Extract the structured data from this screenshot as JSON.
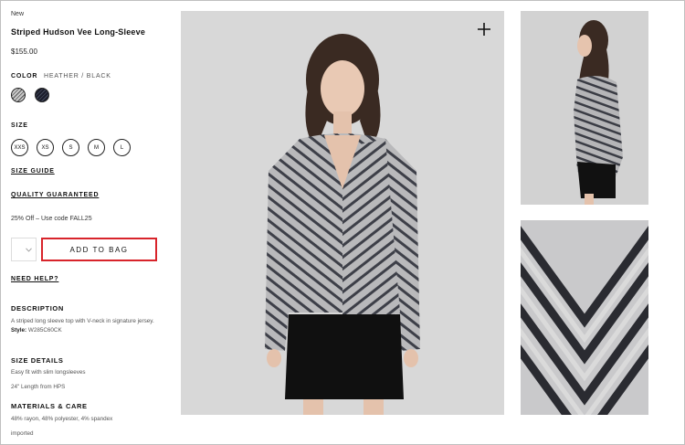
{
  "product": {
    "tag": "New",
    "title": "Striped Hudson Vee Long-Sleeve",
    "price": "$155.00"
  },
  "color": {
    "label": "COLOR",
    "value": "HEATHER / BLACK",
    "swatches": [
      "heather-grey",
      "black"
    ]
  },
  "size": {
    "label": "SIZE",
    "options": [
      "XXS",
      "XS",
      "S",
      "M",
      "L"
    ]
  },
  "links": {
    "size_guide": "SIZE GUIDE",
    "quality": "QUALITY GUARANTEED",
    "need_help": "NEED HELP?"
  },
  "promo": "25% Off – Use code FALL25",
  "cart": {
    "qty_value": "",
    "add_to_bag": "ADD TO BAG"
  },
  "description": {
    "heading": "DESCRIPTION",
    "text": "A striped long sleeve top with V-neck in signature jersey.",
    "style_label": "Style:",
    "style_code": "W285C60CK"
  },
  "size_details": {
    "heading": "SIZE DETAILS",
    "fit": "Easy fit with slim longsleeves",
    "length": "24\" Length from HPS"
  },
  "materials": {
    "heading": "MATERIALS & CARE",
    "composition": "48% rayon, 48% polyester, 4% spandex",
    "origin": "imported"
  },
  "colors": {
    "accent_outline": "#d8242b",
    "text": "#111111"
  }
}
